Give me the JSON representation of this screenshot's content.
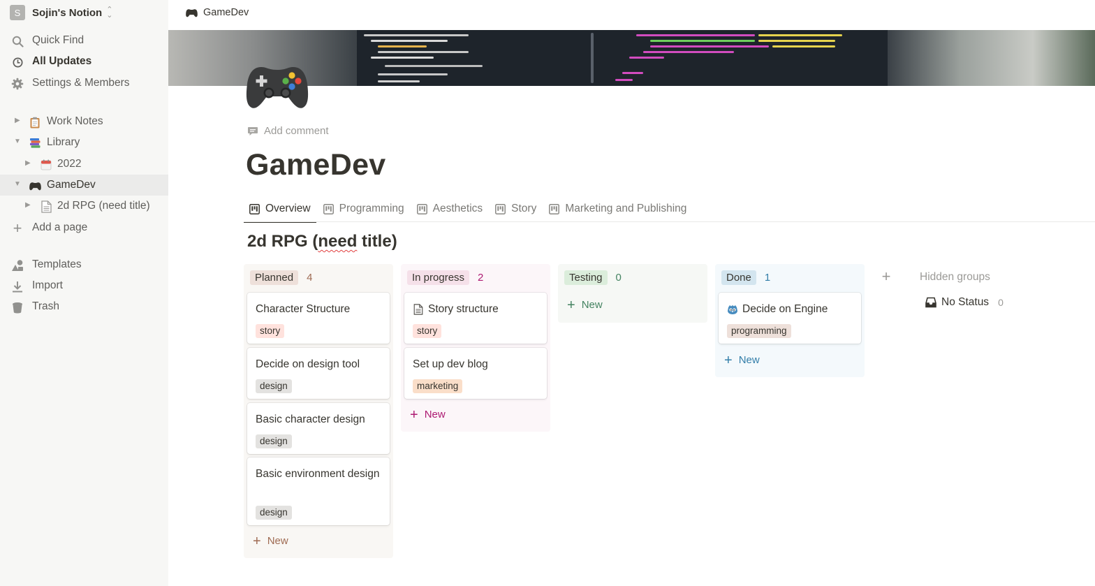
{
  "workspace": {
    "avatar": "S",
    "name": "Sojin's Notion",
    "chevron_icon": "chevron-up-down-icon"
  },
  "sidebar": {
    "nav": [
      {
        "label": "Quick Find",
        "icon": "search-icon"
      },
      {
        "label": "All Updates",
        "icon": "clock-icon"
      },
      {
        "label": "Settings & Members",
        "icon": "gear-icon"
      }
    ],
    "pages": [
      {
        "label": "Work Notes",
        "icon": "clipboard-emoji",
        "expanded": false
      },
      {
        "label": "Library",
        "icon": "books-emoji",
        "expanded": true
      },
      {
        "label": "2022",
        "icon": "calendar-emoji",
        "expanded": false
      },
      {
        "label": "GameDev",
        "icon": "game-controller-emoji",
        "expanded": true,
        "active": true
      },
      {
        "label": "2d RPG (need title)",
        "icon": "page-icon",
        "expanded": false
      }
    ],
    "add_page": "Add a page",
    "footer": [
      {
        "label": "Templates",
        "icon": "shapes-icon"
      },
      {
        "label": "Import",
        "icon": "download-icon"
      },
      {
        "label": "Trash",
        "icon": "trash-icon"
      }
    ]
  },
  "breadcrumb": {
    "label": "GameDev",
    "icon": "game-controller-emoji"
  },
  "page": {
    "icon": "game-controller-emoji",
    "add_comment": "Add comment",
    "title": "GameDev"
  },
  "tabs": [
    {
      "label": "Overview",
      "active": true
    },
    {
      "label": "Programming"
    },
    {
      "label": "Aesthetics"
    },
    {
      "label": "Story"
    },
    {
      "label": "Marketing and Publishing"
    }
  ],
  "database": {
    "title_prefix": "2d RPG (",
    "title_misspelled": "need",
    "title_suffix": " title)",
    "new_label": "New",
    "groups": [
      {
        "name": "Planned",
        "count": "4",
        "colors": {
          "bg": "#f9f7f4",
          "pill": "#eee0da",
          "text": "#9f6b53"
        },
        "cards": [
          {
            "title": "Character Structure",
            "tag": "story",
            "tag_color": "#ffe2dd"
          },
          {
            "title": "Decide on design tool",
            "tag": "design",
            "tag_color": "#e3e2e0"
          },
          {
            "title": "Basic character design",
            "tag": "design",
            "tag_color": "#e3e2e0"
          },
          {
            "title": "Basic environment design",
            "tag": "design",
            "tag_color": "#e3e2e0"
          }
        ]
      },
      {
        "name": "In progress",
        "count": "2",
        "colors": {
          "bg": "#fcf6f9",
          "pill": "#f5e0e9",
          "text": "#ad1a72"
        },
        "cards": [
          {
            "title": "Story structure",
            "tag": "story",
            "tag_color": "#ffe2dd",
            "icon": "page-icon"
          },
          {
            "title": "Set up dev blog",
            "tag": "marketing",
            "tag_color": "#fadec9"
          }
        ]
      },
      {
        "name": "Testing",
        "count": "0",
        "colors": {
          "bg": "#f6f8f5",
          "pill": "#dbeddb",
          "text": "#448361"
        },
        "cards": []
      },
      {
        "name": "Done",
        "count": "1",
        "colors": {
          "bg": "#f4f9fc",
          "pill": "#d3e5ef",
          "text": "#337ea9"
        },
        "cards": [
          {
            "title": "Decide on Engine",
            "tag": "programming",
            "tag_color": "#eee0da",
            "icon": "godot-icon"
          }
        ]
      }
    ],
    "hidden_groups_label": "Hidden groups",
    "hidden_groups": [
      {
        "name": "No Status",
        "count": "0",
        "icon": "inbox-icon"
      }
    ]
  }
}
